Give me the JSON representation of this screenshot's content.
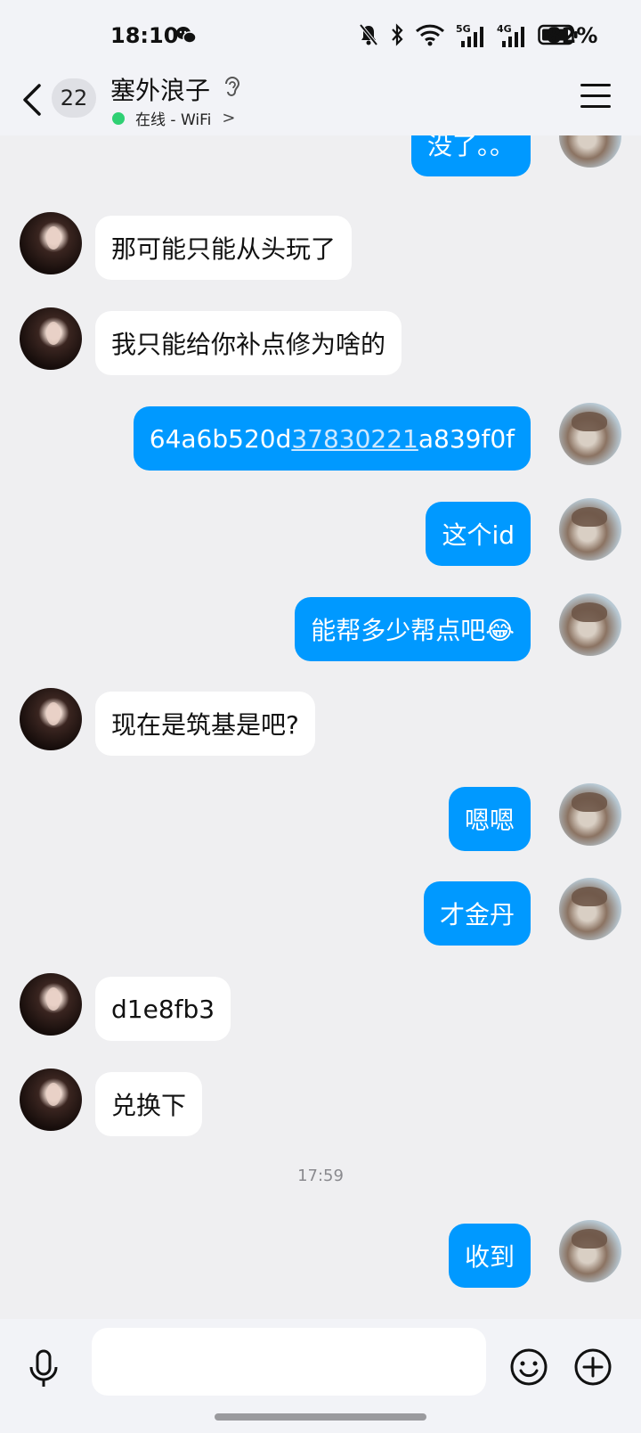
{
  "status_bar": {
    "time": "18:10",
    "battery": "82%",
    "network_5g": "5G",
    "network_4g": "4G",
    "icons": [
      "wechat-icon",
      "mute-bell-icon",
      "bluetooth-icon",
      "wifi-icon",
      "signal-icon",
      "battery-icon"
    ]
  },
  "header": {
    "unread_count": "22",
    "contact_name": "塞外浪子",
    "online_status": "在线 - WiFi",
    "online_chevron": ">",
    "online_dot_color": "#2fd073"
  },
  "messages": [
    {
      "side": "out",
      "text": "没了。。"
    },
    {
      "side": "in",
      "text": "那可能只能从头玩了"
    },
    {
      "side": "in",
      "text": "我只能给你补点修为啥的"
    },
    {
      "side": "out",
      "text_prefix": "64a6b520d",
      "text_link": "37830221",
      "text_suffix": "a839f0f"
    },
    {
      "side": "out",
      "text": "这个id"
    },
    {
      "side": "out",
      "text": "能帮多少帮点吧😂"
    },
    {
      "side": "in",
      "text": "现在是筑基是吧?"
    },
    {
      "side": "out",
      "text": "嗯嗯"
    },
    {
      "side": "out",
      "text": "才金丹"
    },
    {
      "side": "in",
      "text": "d1e8fb3"
    },
    {
      "side": "in",
      "text": "兑换下"
    },
    {
      "side": "out",
      "text": "收到"
    }
  ],
  "time_separator": "17:59",
  "colors": {
    "out_bubble": "#0099ff",
    "in_bubble": "#ffffff",
    "background": "#efeff1"
  },
  "input_bar": {
    "placeholder": "",
    "icons": [
      "microphone-icon",
      "emoji-icon",
      "plus-icon"
    ]
  }
}
